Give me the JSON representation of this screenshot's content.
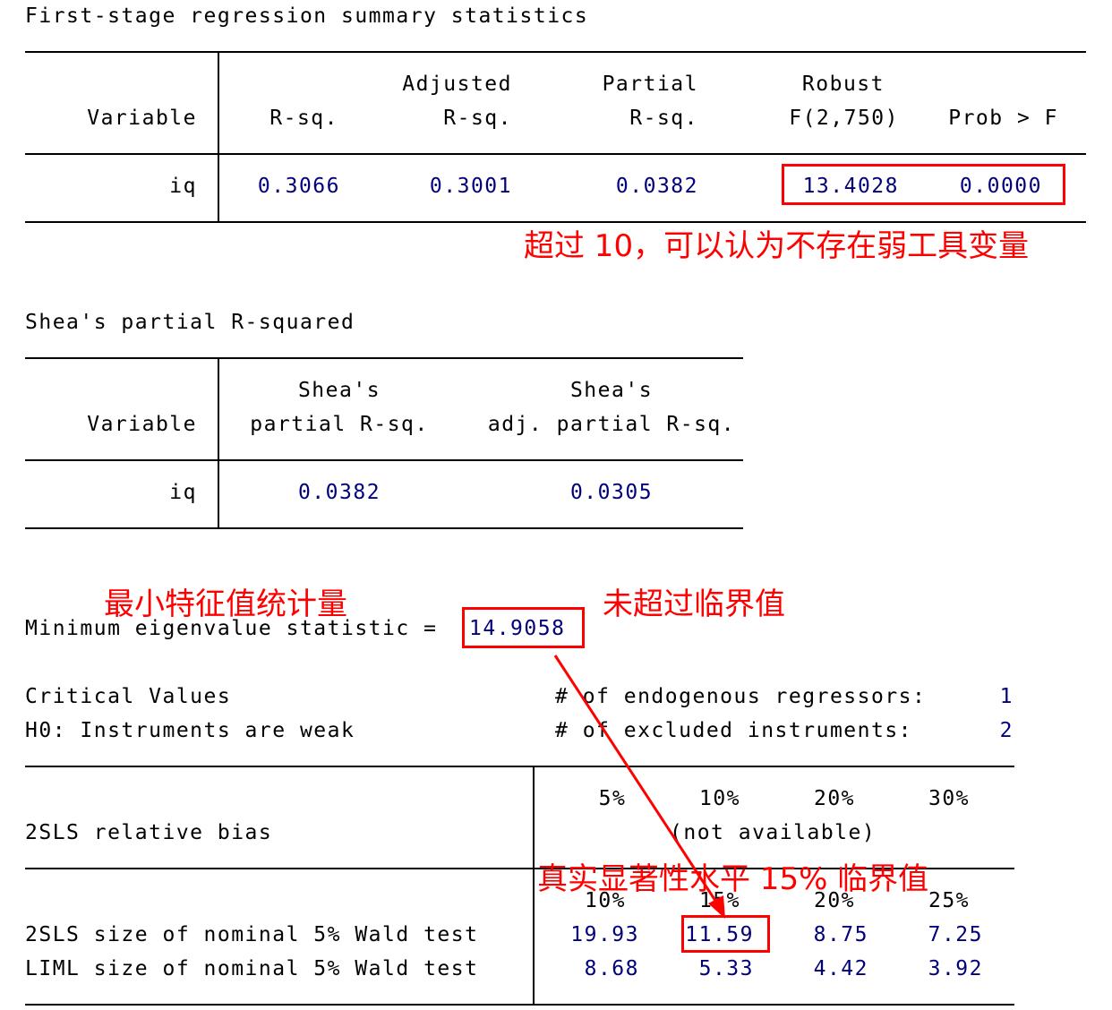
{
  "first_stage": {
    "title": "First-stage regression summary statistics",
    "headers": {
      "variable": "Variable",
      "rsq_line2": "R-sq.",
      "adj_line1": "Adjusted",
      "adj_line2": "R-sq.",
      "partial_line1": "Partial",
      "partial_line2": "R-sq.",
      "robust_line1": "Robust",
      "robust_line2": "F(2,750)",
      "prob": "Prob > F"
    },
    "row": {
      "variable": "iq",
      "rsq": "0.3066",
      "adj_rsq": "0.3001",
      "partial_rsq": "0.0382",
      "f": "13.4028",
      "prob": "0.0000"
    }
  },
  "shea": {
    "title": "Shea's partial R-squared",
    "headers": {
      "variable": "Variable",
      "col1_line1": "Shea's",
      "col1_line2": "partial R-sq.",
      "col2_line1": "Shea's",
      "col2_line2": "adj. partial R-sq."
    },
    "row": {
      "variable": "iq",
      "partial": "0.0382",
      "adj_partial": "0.0305"
    }
  },
  "eigen": {
    "label": "Minimum eigenvalue statistic =",
    "value": "14.9058"
  },
  "critical": {
    "title": "Critical Values",
    "h0": "H0: Instruments are weak",
    "endog_label": "# of endogenous regressors:",
    "endog_value": "1",
    "excl_label": "# of excluded instruments:",
    "excl_value": "2",
    "bias": {
      "label": "2SLS relative bias",
      "levels": [
        "5%",
        "10%",
        "20%",
        "30%"
      ],
      "note": "(not available)"
    },
    "size": {
      "levels": [
        "10%",
        "15%",
        "20%",
        "25%"
      ],
      "rows": [
        {
          "label": "2SLS size of nominal 5% Wald test",
          "values": [
            "19.93",
            "11.59",
            "8.75",
            "7.25"
          ]
        },
        {
          "label": "LIML size of nominal 5% Wald test",
          "values": [
            "8.68",
            "5.33",
            "4.42",
            "3.92"
          ]
        }
      ]
    }
  },
  "annotations": {
    "over10": "超过 10，可以认为不存在弱工具变量",
    "min_eigen": "最小特征值统计量",
    "not_exceed": "未超过临界值",
    "true_level": "真实显著性水平 15% 临界值"
  },
  "colors": {
    "number": "#00007a",
    "annotation": "#ff0000",
    "rule": "#000000"
  }
}
